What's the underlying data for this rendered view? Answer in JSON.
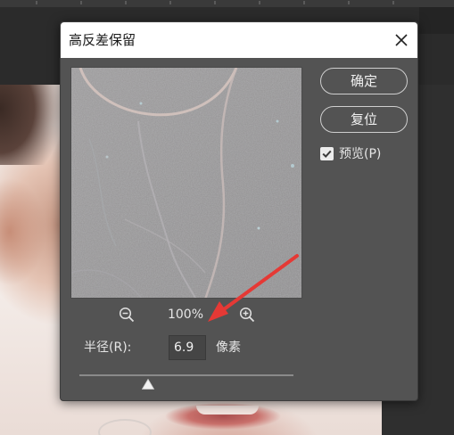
{
  "dialog": {
    "title": "高反差保留",
    "ok_label": "确定",
    "reset_label": "复位",
    "preview_label": "预览(P)",
    "preview_checked": true,
    "zoom_level": "100%",
    "radius_label": "半径(R):",
    "radius_value": "6.9",
    "radius_unit": "像素",
    "slider_fraction": 0.32
  },
  "icons": {
    "close": "close-icon",
    "zoom_out": "zoom-out-icon",
    "zoom_in": "zoom-in-icon",
    "checkmark": "checkmark-icon"
  },
  "colors": {
    "dialog_bg": "#535353",
    "titlebar_bg": "#ffffff",
    "annotation_arrow": "#e53935"
  }
}
